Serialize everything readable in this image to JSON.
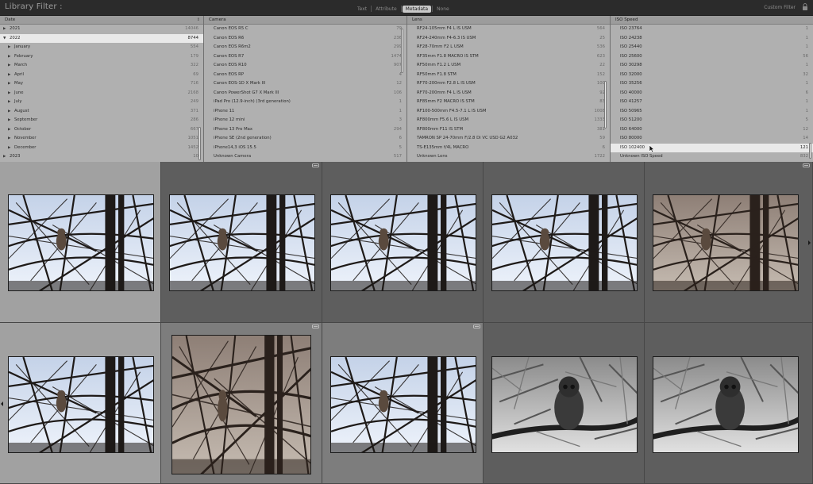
{
  "filter_bar": {
    "title": "Library Filter :",
    "modes": [
      "Text",
      "Attribute",
      "Metadata",
      "None"
    ],
    "active_mode": "Metadata",
    "preset": "Custom Filter",
    "preset_icon": "chevron-down-icon",
    "lock_icon": "lock-icon"
  },
  "columns": {
    "date": {
      "header": "Date",
      "rows": [
        {
          "label": "2021",
          "count": "14046",
          "level": 0,
          "expanded": false
        },
        {
          "label": "2022",
          "count": "8744",
          "level": 0,
          "expanded": true,
          "selected": true
        },
        {
          "label": "January",
          "count": "554",
          "level": 1
        },
        {
          "label": "February",
          "count": "179",
          "level": 1
        },
        {
          "label": "March",
          "count": "322",
          "level": 1
        },
        {
          "label": "April",
          "count": "69",
          "level": 1
        },
        {
          "label": "May",
          "count": "716",
          "level": 1
        },
        {
          "label": "June",
          "count": "2168",
          "level": 1
        },
        {
          "label": "July",
          "count": "249",
          "level": 1
        },
        {
          "label": "August",
          "count": "371",
          "level": 1
        },
        {
          "label": "September",
          "count": "286",
          "level": 1
        },
        {
          "label": "October",
          "count": "667",
          "level": 1
        },
        {
          "label": "November",
          "count": "1051",
          "level": 1
        },
        {
          "label": "December",
          "count": "1452",
          "level": 1
        },
        {
          "label": "2023",
          "count": "10",
          "level": 0,
          "expanded": false
        }
      ]
    },
    "camera": {
      "header": "Camera",
      "rows": [
        {
          "label": "Canon EOS R5 C",
          "count": "79"
        },
        {
          "label": "Canon EOS R6",
          "count": "236"
        },
        {
          "label": "Canon EOS R6m2",
          "count": "299"
        },
        {
          "label": "Canon EOS R7",
          "count": "1474"
        },
        {
          "label": "Canon EOS R10",
          "count": "907"
        },
        {
          "label": "Canon EOS RP",
          "count": "4"
        },
        {
          "label": "Canon EOS-1D X Mark III",
          "count": "12"
        },
        {
          "label": "Canon PowerShot G7 X Mark III",
          "count": "106"
        },
        {
          "label": "iPad Pro (12.9-inch) (3rd generation)",
          "count": "1"
        },
        {
          "label": "iPhone 11",
          "count": "1"
        },
        {
          "label": "iPhone 12 mini",
          "count": "3"
        },
        {
          "label": "iPhone 13 Pro Max",
          "count": "294"
        },
        {
          "label": "iPhone SE (2nd generation)",
          "count": "6"
        },
        {
          "label": "iPhone14,3 iOS 15.5",
          "count": "5"
        },
        {
          "label": "Unknown Camera",
          "count": "517"
        }
      ]
    },
    "lens": {
      "header": "Lens",
      "rows": [
        {
          "label": "RF24-105mm F4 L IS USM",
          "count": "564"
        },
        {
          "label": "RF24-240mm F4-6.3 IS USM",
          "count": "25"
        },
        {
          "label": "RF28-70mm F2 L USM",
          "count": "536"
        },
        {
          "label": "RF35mm F1.8 MACRO IS STM",
          "count": "623"
        },
        {
          "label": "RF50mm F1.2 L USM",
          "count": "22"
        },
        {
          "label": "RF50mm F1.8 STM",
          "count": "152"
        },
        {
          "label": "RF70-200mm F2.8 L IS USM",
          "count": "100"
        },
        {
          "label": "RF70-200mm F4 L IS USM",
          "count": "92"
        },
        {
          "label": "RF85mm F2 MACRO IS STM",
          "count": "83"
        },
        {
          "label": "RF100-500mm F4.5-7.1 L IS USM",
          "count": "1008"
        },
        {
          "label": "RF800mm F5.6 L IS USM",
          "count": "1333"
        },
        {
          "label": "RF800mm F11 IS STM",
          "count": "381"
        },
        {
          "label": "TAMRON SP 24-70mm F/2.8 Di VC USD G2 A032",
          "count": "59"
        },
        {
          "label": "TS-E135mm f/4L MACRO",
          "count": "6"
        },
        {
          "label": "Unknown Lens",
          "count": "1722"
        }
      ]
    },
    "iso": {
      "header": "ISO Speed",
      "rows": [
        {
          "label": "ISO 23764",
          "count": "1"
        },
        {
          "label": "ISO 24238",
          "count": "1"
        },
        {
          "label": "ISO 25440",
          "count": "1"
        },
        {
          "label": "ISO 25600",
          "count": "56"
        },
        {
          "label": "ISO 30298",
          "count": "1"
        },
        {
          "label": "ISO 32000",
          "count": "32"
        },
        {
          "label": "ISO 35256",
          "count": "1"
        },
        {
          "label": "ISO 40000",
          "count": "6"
        },
        {
          "label": "ISO 41257",
          "count": "1"
        },
        {
          "label": "ISO 50965",
          "count": "1"
        },
        {
          "label": "ISO 51200",
          "count": "5"
        },
        {
          "label": "ISO 64000",
          "count": "12"
        },
        {
          "label": "ISO 80000",
          "count": "14"
        },
        {
          "label": "ISO 102400",
          "count": "121",
          "selected": true
        },
        {
          "label": "Unknown ISO Speed",
          "count": "832"
        }
      ]
    }
  },
  "grid": {
    "cells": [
      {
        "variant": "cool",
        "state": "selected"
      },
      {
        "variant": "cool",
        "state": "normal",
        "badge": true
      },
      {
        "variant": "cool",
        "state": "normal"
      },
      {
        "variant": "cool",
        "state": "normal"
      },
      {
        "variant": "warm",
        "state": "normal",
        "badge": true
      },
      {
        "variant": "cool",
        "state": "selected"
      },
      {
        "variant": "warm",
        "state": "alt",
        "badge": true
      },
      {
        "variant": "cool",
        "state": "alt",
        "badge": true
      },
      {
        "variant": "bw",
        "state": "normal"
      },
      {
        "variant": "bw",
        "state": "normal"
      }
    ]
  },
  "colors": {
    "background": "#3f3f3f",
    "panel": "#b0b0b0",
    "selected_row": "#e9e9e9",
    "active_mode": "#c9c9c9"
  }
}
